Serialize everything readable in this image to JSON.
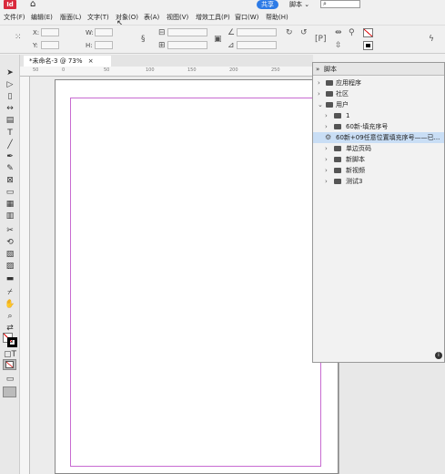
{
  "titlebar": {
    "app_icon": "Id",
    "home_icon": "home-icon",
    "share_label": "共享",
    "workspace_label": "脚本",
    "workspace_chevron": "⌄",
    "search_placeholder": "⌕"
  },
  "menu": {
    "items": [
      "文件(F)",
      "编辑(E)",
      "版面(L)",
      "文字(T)",
      "对象(O)",
      "表(A)",
      "视图(V)",
      "增效工具(P)",
      "窗口(W)",
      "帮助(H)"
    ]
  },
  "control": {
    "x_label": "X:",
    "y_label": "Y:",
    "w_label": "W:",
    "h_label": "H:"
  },
  "document": {
    "tab_label": "*未命名-3 @ 73%",
    "tab_close": "×",
    "ruler_ticks": [
      "50",
      "0",
      "50",
      "100",
      "150",
      "200",
      "250"
    ]
  },
  "scripts_panel": {
    "title": "脚本",
    "rows": [
      {
        "label": "应用程序"
      },
      {
        "label": "社区"
      },
      {
        "label": "用户"
      },
      {
        "label": "1"
      },
      {
        "label": "60新-填充序号"
      },
      {
        "label": "60新+09任意位置填充序号——已..."
      },
      {
        "label": "单边页码"
      },
      {
        "label": "新脚本"
      },
      {
        "label": "新视频"
      },
      {
        "label": "测试3"
      }
    ],
    "info_icon": "i"
  },
  "colors": {
    "app_icon_bg": "#d92a3d",
    "share_bg": "#2d7be6",
    "margin_guide": "#c86bd1",
    "selection": "#c9def5"
  }
}
